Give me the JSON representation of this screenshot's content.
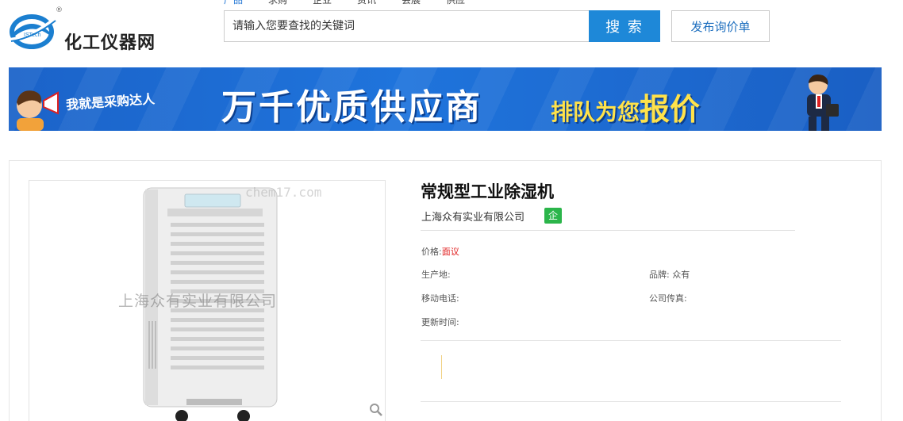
{
  "header": {
    "logo_text": "化工仪器网",
    "logo_small": "ISTech",
    "reg_mark": "®",
    "nav": [
      "产品",
      "求购",
      "企业",
      "资讯",
      "会展",
      "供应"
    ],
    "search_placeholder": "请输入您要查找的关键词",
    "search_button": "搜 索",
    "inquiry_button": "发布询价单"
  },
  "banner": {
    "left_text": "我就是采购达人",
    "main_text": "万千优质供应商",
    "right_text_a": "排队为您",
    "right_text_b": "报价"
  },
  "product": {
    "title": "常规型工业除湿机",
    "company": "上海众有实业有限公司",
    "company_badge": "企",
    "image_watermark": "上海众有实业有限公司",
    "image_watermark_top": "chem17.com",
    "price_label": "价格:",
    "price_value": "面议",
    "origin_label": "生产地:",
    "origin_value": "",
    "brand_label": "品牌:",
    "brand_value": "众有",
    "mobile_label": "移动电话:",
    "mobile_value": "",
    "fax_label": "公司传真:",
    "fax_value": "",
    "updated_label": "更新时间:",
    "updated_value": ""
  },
  "colors": {
    "accent": "#1e88d8",
    "banner_blue": "#1f74dc",
    "badge_green": "#2bb54a",
    "price_red": "#e02020"
  }
}
